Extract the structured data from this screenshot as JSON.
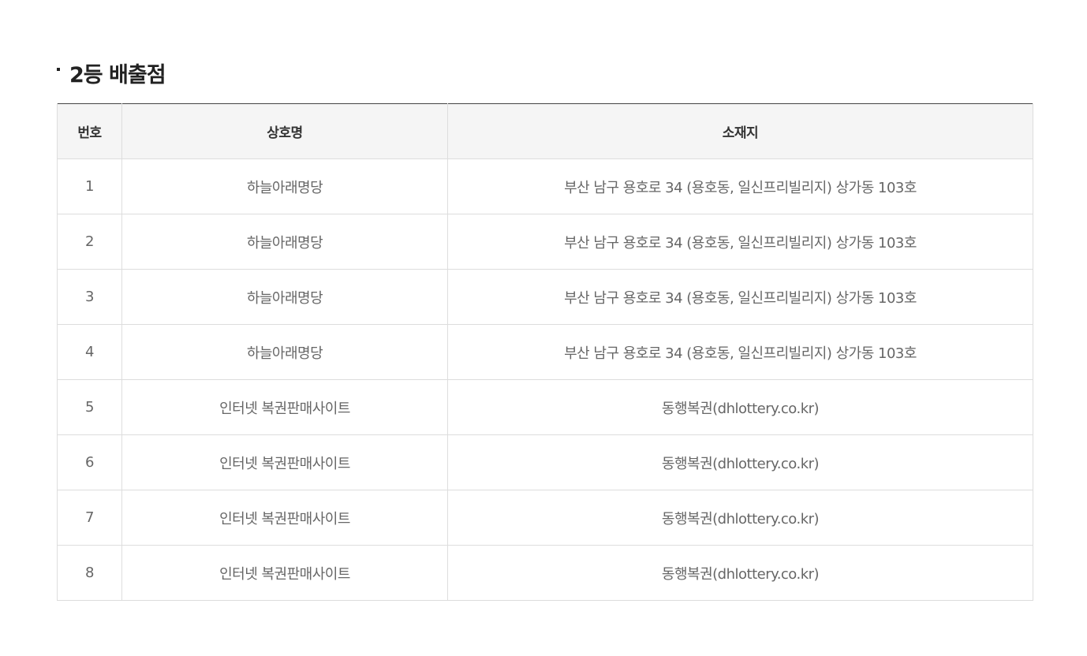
{
  "section": {
    "title": "2등 배출점"
  },
  "table": {
    "headers": {
      "no": "번호",
      "name": "상호명",
      "address": "소재지"
    },
    "rows": [
      {
        "no": "1",
        "name": "하늘아래명당",
        "address": "부산 남구 용호로 34 (용호동, 일신프리빌리지) 상가동 103호"
      },
      {
        "no": "2",
        "name": "하늘아래명당",
        "address": "부산 남구 용호로 34 (용호동, 일신프리빌리지) 상가동 103호"
      },
      {
        "no": "3",
        "name": "하늘아래명당",
        "address": "부산 남구 용호로 34 (용호동, 일신프리빌리지) 상가동 103호"
      },
      {
        "no": "4",
        "name": "하늘아래명당",
        "address": "부산 남구 용호로 34 (용호동, 일신프리빌리지) 상가동 103호"
      },
      {
        "no": "5",
        "name": "인터넷 복권판매사이트",
        "address": "동행복권(dhlottery.co.kr)"
      },
      {
        "no": "6",
        "name": "인터넷 복권판매사이트",
        "address": "동행복권(dhlottery.co.kr)"
      },
      {
        "no": "7",
        "name": "인터넷 복권판매사이트",
        "address": "동행복권(dhlottery.co.kr)"
      },
      {
        "no": "8",
        "name": "인터넷 복권판매사이트",
        "address": "동행복권(dhlottery.co.kr)"
      }
    ]
  }
}
